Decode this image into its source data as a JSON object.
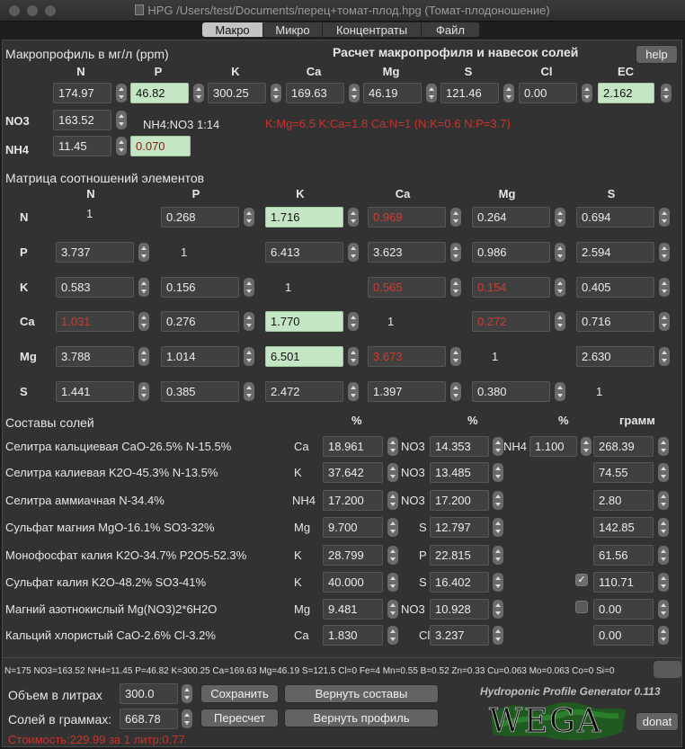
{
  "window": {
    "title": "HPG /Users/test/Documents/перец+томат-плод.hpg (Томат-плодоношение)"
  },
  "tabs": [
    {
      "label": "Макро",
      "active": true
    },
    {
      "label": "Микро"
    },
    {
      "label": "Концентраты"
    },
    {
      "label": "Файл"
    }
  ],
  "macro": {
    "heading": "Макропрофиль в мг/л (ppm)",
    "calc_heading": "Расчет макропрофиля и навесок солей",
    "help": "help",
    "elements": [
      {
        "name": "N",
        "value": "174.97"
      },
      {
        "name": "P",
        "value": "46.82",
        "highlight": true
      },
      {
        "name": "K",
        "value": "300.25"
      },
      {
        "name": "Ca",
        "value": "169.63"
      },
      {
        "name": "Mg",
        "value": "46.19"
      },
      {
        "name": "S",
        "value": "121.46"
      },
      {
        "name": "Cl",
        "value": "0.00"
      },
      {
        "name": "EC",
        "value": "2.162",
        "highlight": true
      }
    ],
    "no3": {
      "label": "NO3",
      "value": "163.52"
    },
    "nh4": {
      "label": "NH4",
      "value": "11.45",
      "ratio": "0.070"
    },
    "nh4_no3_text": "NH4:NO3 1:14",
    "ratios_text": "K:Mg=6.5 K:Ca=1.8 Ca:N=1 (N:K=0.6 N:P=3.7)"
  },
  "matrix": {
    "heading": "Матрица соотношений элементов",
    "headers": [
      "N",
      "P",
      "K",
      "Ca",
      "Mg",
      "S"
    ],
    "rows": [
      {
        "label": "N",
        "cells": [
          "1",
          "0.268",
          "1.716",
          "0.969",
          "0.264",
          "0.694"
        ]
      },
      {
        "label": "P",
        "cells": [
          "3.737",
          "1",
          "6.413",
          "3.623",
          "0.986",
          "2.594"
        ]
      },
      {
        "label": "K",
        "cells": [
          "0.583",
          "0.156",
          "1",
          "0.565",
          "0.154",
          "0.405"
        ]
      },
      {
        "label": "Ca",
        "cells": [
          "1.031",
          "0.276",
          "1.770",
          "1",
          "0.272",
          "0.716"
        ]
      },
      {
        "label": "Mg",
        "cells": [
          "3.788",
          "1.014",
          "6.501",
          "3.673",
          "1",
          "2.630"
        ]
      },
      {
        "label": "S",
        "cells": [
          "1.441",
          "0.385",
          "2.472",
          "1.397",
          "0.380",
          "1"
        ]
      }
    ]
  },
  "salts": {
    "heading": "Составы солей",
    "pct": "%",
    "gram": "грамм",
    "rows": [
      {
        "name": "Селитра кальциевая CaO-26.5% N-15.5%",
        "el1": "Ca",
        "v1": "18.961",
        "el2": "NO3",
        "v2": "14.353",
        "el3": "NH4",
        "v3": "1.100",
        "grams": "268.39"
      },
      {
        "name": "Селитра калиевая K2O-45.3% N-13.5%",
        "el1": "K",
        "v1": "37.642",
        "el2": "NO3",
        "v2": "13.485",
        "grams": "74.55"
      },
      {
        "name": "Селитра аммиачная N-34.4%",
        "el1": "NH4",
        "v1": "17.200",
        "el2": "NO3",
        "v2": "17.200",
        "grams": "2.80"
      },
      {
        "name": "Сульфат магния MgO-16.1% SO3-32%",
        "el1": "Mg",
        "v1": "9.700",
        "el2": "S",
        "v2": "12.797",
        "grams": "142.85"
      },
      {
        "name": "Монофосфат калия K2O-34.7% P2O5-52.3%",
        "el1": "K",
        "v1": "28.799",
        "el2": "P",
        "v2": "22.815",
        "grams": "61.56"
      },
      {
        "name": "Сульфат калия K2O-48.2% SO3-41%",
        "el1": "K",
        "v1": "40.000",
        "el2": "S",
        "v2": "16.402",
        "check": true,
        "checkmark": "✓",
        "grams": "110.71"
      },
      {
        "name": "Магний азотнокислый Mg(NO3)2*6H2O",
        "el1": "Mg",
        "v1": "9.481",
        "el2": "NO3",
        "v2": "10.928",
        "check": false,
        "grams": "0.00"
      },
      {
        "name": "Кальций хлористый CaO-2.6% Cl-3.2%",
        "el1": "Ca",
        "v1": "1.830",
        "el2": "Cl",
        "v2": "3.237",
        "grams": "0.00"
      }
    ]
  },
  "status_line": "N=175 NO3=163.52 NH4=11.45 P=46.82 K=300.25 Ca=169.63 Mg=46.19 S=121.5 Cl=0 Fe=4 Mn=0.55 B=0.52 Zn=0.33 Cu=0.063 Mo=0.063 Co=0 Si=0",
  "bottom": {
    "volume_label": "Объем в литрах",
    "volume_value": "300.0",
    "salts_label": "Солей в граммах:",
    "salts_value": "668.78",
    "save": "Сохранить",
    "restore_compositions": "Вернуть составы",
    "recalc": "Пересчет",
    "restore_profile": "Вернуть профиль",
    "cost": "Стоимость:229.99 за 1 литр:0.77",
    "app_name": "Hydroponic Profile Generator 0.113",
    "logo": "WEGA",
    "donate": "donat"
  }
}
